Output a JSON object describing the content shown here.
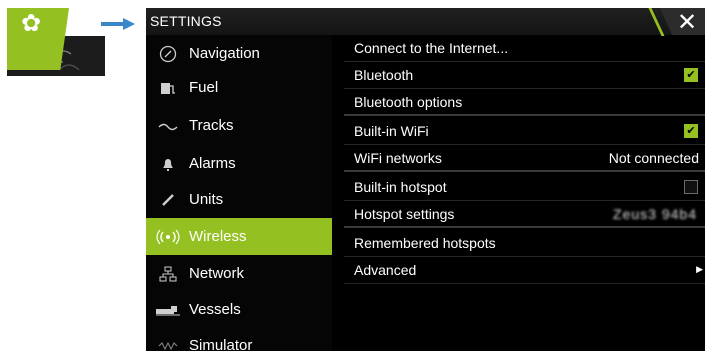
{
  "window": {
    "title": "SETTINGS",
    "close_glyph": "✕"
  },
  "callout": {
    "tile_icon": "gear-icon",
    "tile_glyph": "✿",
    "accent_color": "#94c021"
  },
  "nav": {
    "items": [
      {
        "label": "Navigation",
        "icon": "navigation-icon",
        "glyph": "◴",
        "active": false
      },
      {
        "label": "Fuel",
        "icon": "fuel-icon",
        "glyph": "⛽",
        "active": false
      },
      {
        "label": "Tracks",
        "icon": "tracks-icon",
        "glyph": "⤳",
        "active": false
      },
      {
        "label": "Alarms",
        "icon": "alarm-bell-icon",
        "glyph": "🔔",
        "active": false
      },
      {
        "label": "Units",
        "icon": "units-pencil-icon",
        "glyph": "✎",
        "active": false
      },
      {
        "label": "Wireless",
        "icon": "wireless-icon",
        "glyph": "((•))",
        "active": true
      },
      {
        "label": "Network",
        "icon": "network-icon",
        "glyph": "⊞",
        "active": false
      },
      {
        "label": "Vessels",
        "icon": "vessels-icon",
        "glyph": "▬",
        "active": false
      },
      {
        "label": "Simulator",
        "icon": "simulator-icon",
        "glyph": "〰",
        "active": false
      }
    ]
  },
  "rows": [
    {
      "label": "Connect to the Internet...",
      "kind": "action"
    },
    {
      "label": "Bluetooth",
      "kind": "checkbox",
      "checked": true
    },
    {
      "label": "Bluetooth options",
      "kind": "action"
    },
    {
      "label": "Built-in WiFi",
      "kind": "checkbox",
      "checked": true
    },
    {
      "label": "WiFi networks",
      "kind": "value",
      "value": "Not connected"
    },
    {
      "label": "Built-in hotspot",
      "kind": "checkbox",
      "checked": false
    },
    {
      "label": "Hotspot settings",
      "kind": "value",
      "value": "Zeus3 94b4",
      "blurred": true
    },
    {
      "label": "Remembered hotspots",
      "kind": "action"
    },
    {
      "label": "Advanced",
      "kind": "submenu"
    }
  ],
  "check_glyph": "✔",
  "submenu_glyph": "▶"
}
